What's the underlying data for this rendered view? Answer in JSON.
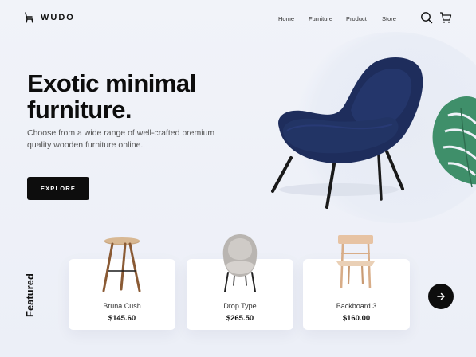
{
  "brand": {
    "name": "WUDO",
    "logo_icon": "chair-logo-icon"
  },
  "nav": {
    "items": [
      {
        "label": "Home"
      },
      {
        "label": "Furniture"
      },
      {
        "label": "Product"
      },
      {
        "label": "Store"
      }
    ],
    "search_icon": "search-icon",
    "cart_icon": "cart-icon"
  },
  "hero": {
    "title_line1": "Exotic minimal",
    "title_line2": "furniture.",
    "subtitle": "Choose from a wide range of well-crafted premium quality wooden furniture online.",
    "cta_label": "EXPLORE",
    "image": "navy-lounge-chair-with-plant"
  },
  "featured": {
    "label": "Featured",
    "products": [
      {
        "name": "Bruna Cush",
        "price": "$145.60",
        "image": "wooden-bar-stool"
      },
      {
        "name": "Drop Type",
        "price": "$265.50",
        "image": "grey-armchair"
      },
      {
        "name": "Backboard 3",
        "price": "$160.00",
        "image": "wooden-chair"
      }
    ],
    "next_icon": "arrow-right-icon"
  },
  "colors": {
    "accent": "#0d0d0d",
    "background": "#eef1f8",
    "chair": "#1e2d5c",
    "plant": "#3f8f6a"
  }
}
